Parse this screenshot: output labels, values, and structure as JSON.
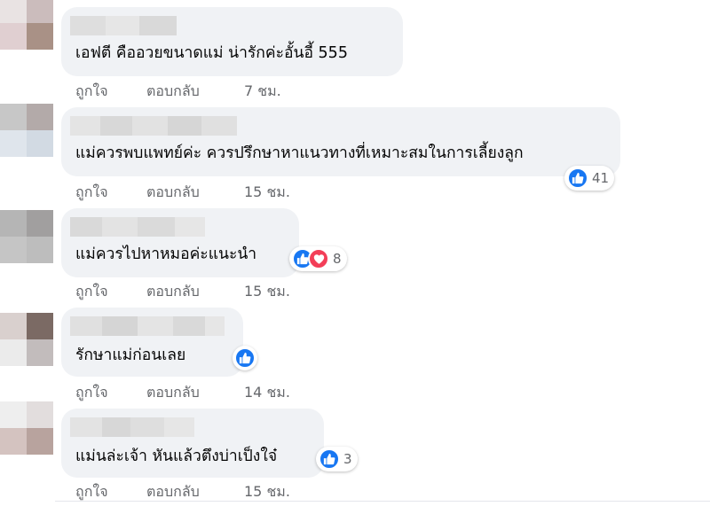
{
  "action_labels": {
    "like": "ถูกใจ",
    "reply": "ตอบกลับ"
  },
  "colors": {
    "like_blue": "#1877f2",
    "love_red": "#f33e58",
    "bubble_bg": "#f0f2f5",
    "meta_gray": "#65676b"
  },
  "comments": [
    {
      "text": "เอฟตี คืออวยขนาดแม่ น่ารักค่ะอั้นอี้ 555",
      "time": "7 ชม.",
      "reactions": null
    },
    {
      "text": "แม่ควรพบแพทย์ค่ะ ควรปรึกษาหาแนวทางที่เหมาะสมในการเลี้ยงลูก",
      "time": "15 ชม.",
      "reactions": {
        "icons": [
          "like-icon"
        ],
        "count": "41"
      }
    },
    {
      "text": "แม่ควรไปหาหมอค่ะแนะนำ",
      "time": "15 ชม.",
      "reactions": {
        "icons": [
          "like-icon",
          "love-icon"
        ],
        "count": "8"
      }
    },
    {
      "text": "รักษาแม่ก่อนเลย",
      "time": "14 ชม.",
      "reactions": {
        "icons": [
          "like-icon"
        ],
        "count": ""
      }
    },
    {
      "text": "แม่นล่ะเจ้า หันแล้วตึงบ่าเป็งใจ๋",
      "time": "15 ชม.",
      "reactions": {
        "icons": [
          "like-icon"
        ],
        "count": "3"
      }
    }
  ]
}
